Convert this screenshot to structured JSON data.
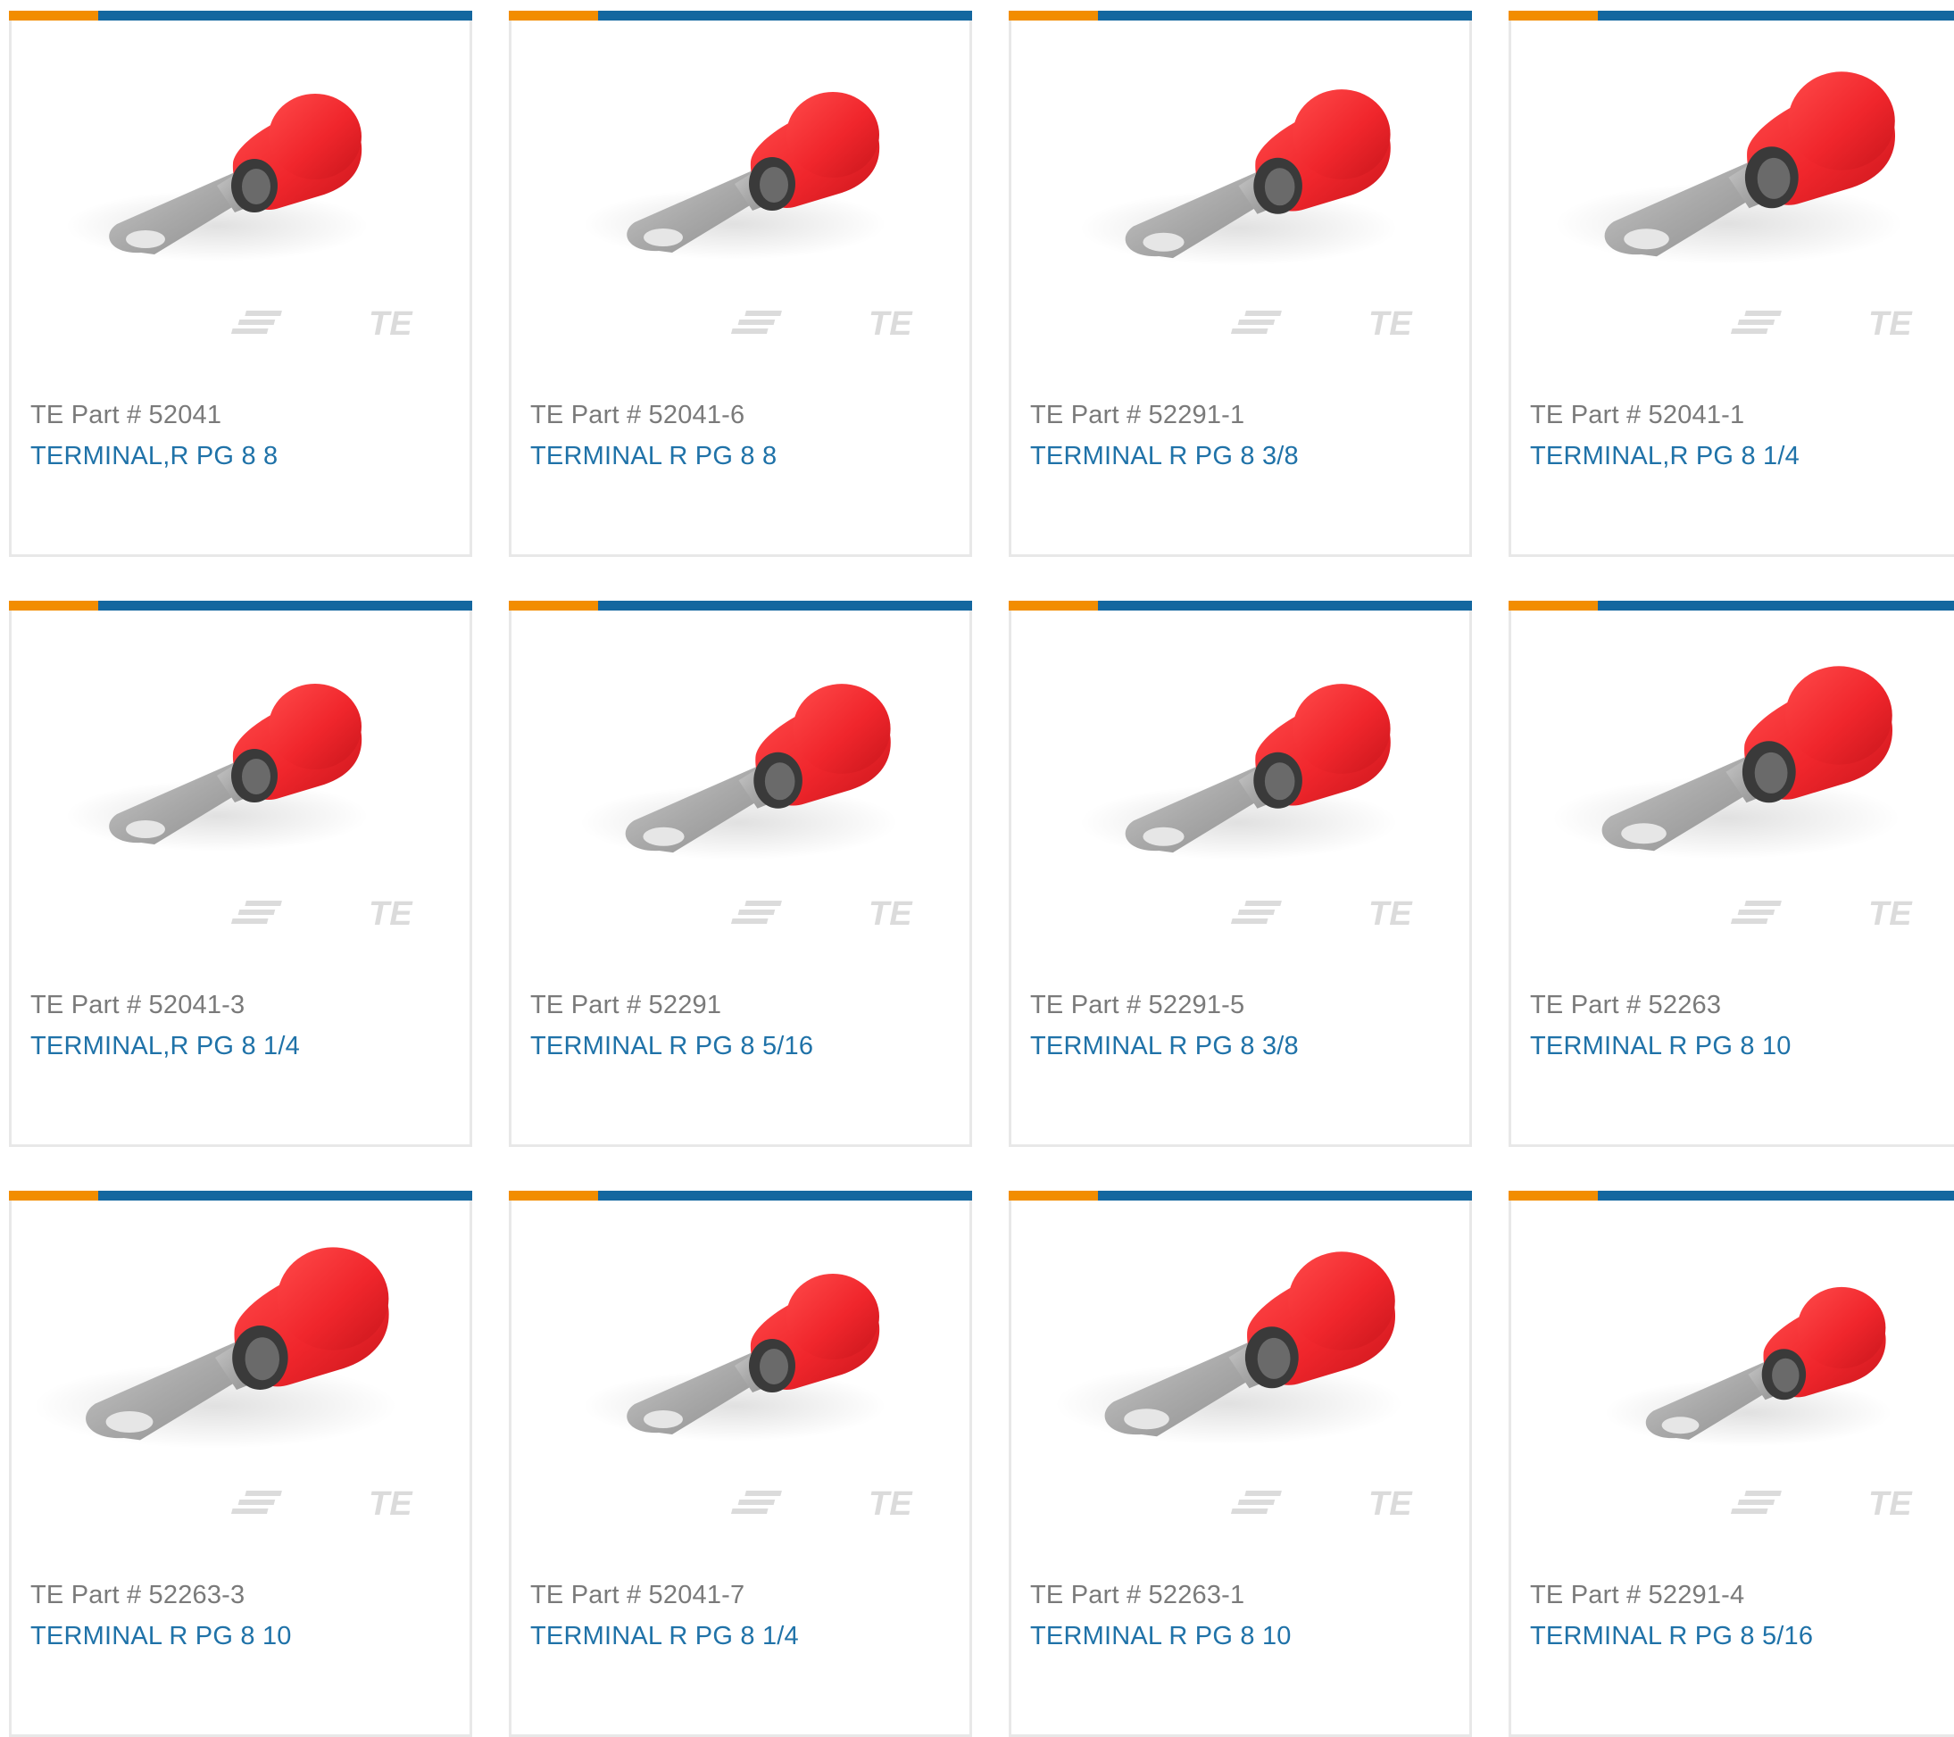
{
  "brand_colors": {
    "accent_orange": "#f28d00",
    "accent_blue": "#14679f",
    "part_text": "#7a7a7a",
    "link_text": "#1f72a8",
    "insulation_red": "#f0262c"
  },
  "product_image_icon": "ring-terminal-red-icon",
  "watermark_logo": "TE",
  "products": [
    {
      "part_label": "TE Part # 52041",
      "description": "TERMINAL,R PG 8 8"
    },
    {
      "part_label": "TE Part # 52041-6",
      "description": "TERMINAL R PG 8 8"
    },
    {
      "part_label": "TE Part # 52291-1",
      "description": "TERMINAL R PG 8 3/8"
    },
    {
      "part_label": "TE Part # 52041-1",
      "description": "TERMINAL,R PG 8 1/4"
    },
    {
      "part_label": "TE Part # 52041-3",
      "description": "TERMINAL,R PG 8 1/4"
    },
    {
      "part_label": "TE Part # 52291",
      "description": "TERMINAL R PG 8 5/16"
    },
    {
      "part_label": "TE Part # 52291-5",
      "description": "TERMINAL R PG 8 3/8"
    },
    {
      "part_label": "TE Part # 52263",
      "description": "TERMINAL R PG 8 10"
    },
    {
      "part_label": "TE Part # 52263-3",
      "description": "TERMINAL R PG 8 10"
    },
    {
      "part_label": "TE Part # 52041-7",
      "description": "TERMINAL R PG 8 1/4"
    },
    {
      "part_label": "TE Part # 52263-1",
      "description": "TERMINAL R PG 8 10"
    },
    {
      "part_label": "TE Part # 52291-4",
      "description": "TERMINAL R PG 8 5/16"
    }
  ]
}
